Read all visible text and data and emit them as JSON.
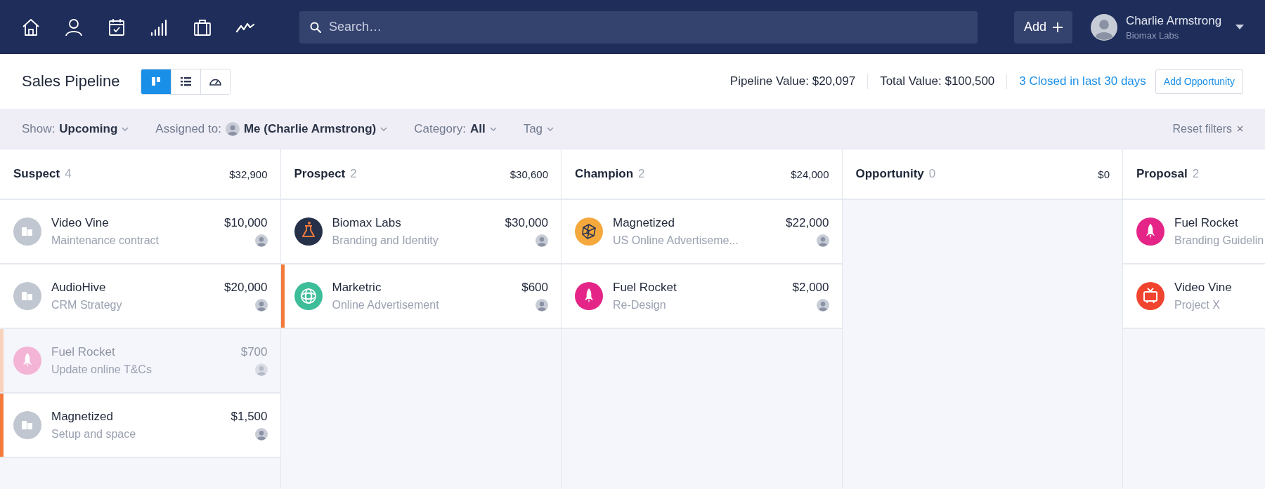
{
  "topbar": {
    "nav": [
      {
        "kind": "home"
      },
      {
        "kind": "person"
      },
      {
        "kind": "calendar"
      },
      {
        "kind": "bars"
      },
      {
        "kind": "briefcase"
      },
      {
        "kind": "trend"
      }
    ],
    "search": {
      "placeholder": "Search…"
    },
    "add_button": "Add",
    "user": {
      "name": "Charlie Armstrong",
      "company": "Biomax Labs"
    }
  },
  "header": {
    "title": "Sales Pipeline",
    "views": [
      {
        "kind": "board",
        "selected": true
      },
      {
        "kind": "list",
        "selected": false
      },
      {
        "kind": "gauge",
        "selected": false
      }
    ],
    "pipeline_value": "Pipeline Value: $20,097",
    "total_value": "Total Value: $100,500",
    "closed_link": "3 Closed in last 30 days",
    "add_opportunity": "Add Opportunity"
  },
  "filters": [
    {
      "label": "Show:",
      "value": "Upcoming",
      "avatar": false
    },
    {
      "label": "Assigned to:",
      "value": "Me (Charlie Armstrong)",
      "avatar": true
    },
    {
      "label": "Category:",
      "value": "All",
      "avatar": false
    },
    {
      "label": "Tag",
      "avatar": false
    }
  ],
  "reset_filters": "Reset filters",
  "columns": [
    {
      "name": "Suspect",
      "count": "4",
      "total": "$32,900",
      "cards": [
        {
          "title": "Video Vine",
          "subtitle": "Maintenance contract",
          "amount": "$10,000",
          "kind": "building",
          "color": "#c1c7d0",
          "flagged": false,
          "dimmed": false,
          "avatar": true
        },
        {
          "title": "AudioHive",
          "subtitle": "CRM Strategy",
          "amount": "$20,000",
          "kind": "building",
          "color": "#c1c7d0",
          "flagged": false,
          "dimmed": false,
          "avatar": true
        },
        {
          "title": "Fuel Rocket",
          "subtitle": "Update online T&Cs",
          "amount": "$700",
          "kind": "rocket",
          "color": "#f3b4d6",
          "flagged": true,
          "dimmed": true,
          "avatar": true
        },
        {
          "title": "Magnetized",
          "subtitle": "Setup and space",
          "amount": "$1,500",
          "kind": "building",
          "color": "#c1c7d0",
          "flagged": true,
          "dimmed": false,
          "avatar": true
        }
      ]
    },
    {
      "name": "Prospect",
      "count": "2",
      "total": "$30,600",
      "cards": [
        {
          "title": "Biomax Labs",
          "subtitle": "Branding and Identity",
          "amount": "$30,000",
          "kind": "flask",
          "color": "#263049",
          "flagged": false,
          "dimmed": false,
          "avatar": true
        },
        {
          "title": "Marketric",
          "subtitle": "Online Advertisement",
          "amount": "$600",
          "kind": "rings",
          "color": "#3dbd9a",
          "flagged": true,
          "dimmed": false,
          "avatar": true
        }
      ]
    },
    {
      "name": "Champion",
      "count": "2",
      "total": "$24,000",
      "cards": [
        {
          "title": "Magnetized",
          "subtitle": "US Online Advertiseme...",
          "amount": "$22,000",
          "kind": "cube",
          "color": "#f5a93d",
          "flagged": false,
          "dimmed": false,
          "avatar": true
        },
        {
          "title": "Fuel Rocket",
          "subtitle": "Re-Design",
          "amount": "$2,000",
          "kind": "rocket",
          "color": "#e42587",
          "flagged": false,
          "dimmed": false,
          "avatar": true
        }
      ]
    },
    {
      "name": "Opportunity",
      "count": "0",
      "total": "$0"
    },
    {
      "name": "Proposal",
      "count": "2",
      "cards": [
        {
          "title": "Fuel Rocket",
          "subtitle": "Branding Guidelin",
          "kind": "rocket",
          "color": "#e42587",
          "flagged": false,
          "dimmed": false
        },
        {
          "title": "Video Vine",
          "subtitle": "Project X",
          "kind": "tv",
          "color": "#f0442f",
          "flagged": false,
          "dimmed": false
        }
      ]
    }
  ]
}
